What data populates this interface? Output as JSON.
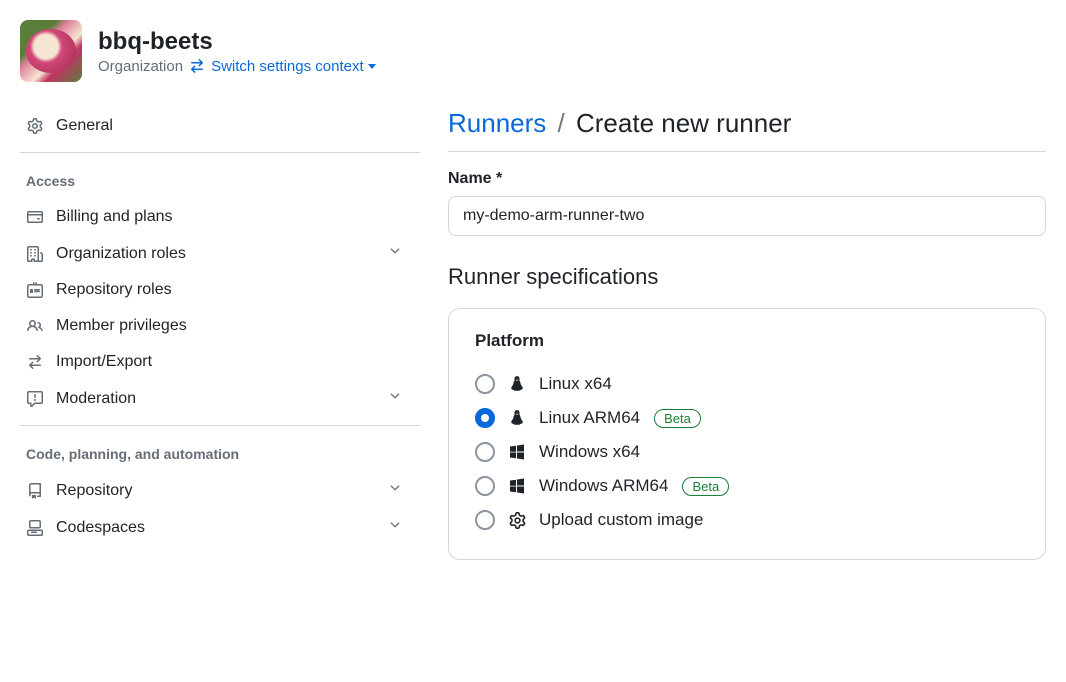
{
  "header": {
    "org_name": "bbq-beets",
    "sub_label": "Organization",
    "switch_link": "Switch settings context"
  },
  "sidebar": {
    "general": "General",
    "section_access": "Access",
    "access_items": [
      {
        "label": "Billing and plans",
        "icon": "credit-card",
        "expandable": false
      },
      {
        "label": "Organization roles",
        "icon": "organization",
        "expandable": true
      },
      {
        "label": "Repository roles",
        "icon": "id-badge",
        "expandable": false
      },
      {
        "label": "Member privileges",
        "icon": "people",
        "expandable": false
      },
      {
        "label": "Import/Export",
        "icon": "arrow-switch",
        "expandable": false
      },
      {
        "label": "Moderation",
        "icon": "report",
        "expandable": true
      }
    ],
    "section_code": "Code, planning, and automation",
    "code_items": [
      {
        "label": "Repository",
        "icon": "repo",
        "expandable": true
      },
      {
        "label": "Codespaces",
        "icon": "codespaces",
        "expandable": true
      }
    ]
  },
  "main": {
    "breadcrumb_link": "Runners",
    "breadcrumb_sep": "/",
    "breadcrumb_current": "Create new runner",
    "name_label": "Name *",
    "name_value": "my-demo-arm-runner-two",
    "spec_heading": "Runner specifications",
    "platform_label": "Platform",
    "platforms": [
      {
        "label": "Linux x64",
        "icon": "linux",
        "selected": false,
        "badge": null
      },
      {
        "label": "Linux ARM64",
        "icon": "linux",
        "selected": true,
        "badge": "Beta"
      },
      {
        "label": "Windows x64",
        "icon": "windows",
        "selected": false,
        "badge": null
      },
      {
        "label": "Windows ARM64",
        "icon": "windows",
        "selected": false,
        "badge": "Beta"
      },
      {
        "label": "Upload custom image",
        "icon": "gear",
        "selected": false,
        "badge": null
      }
    ]
  }
}
